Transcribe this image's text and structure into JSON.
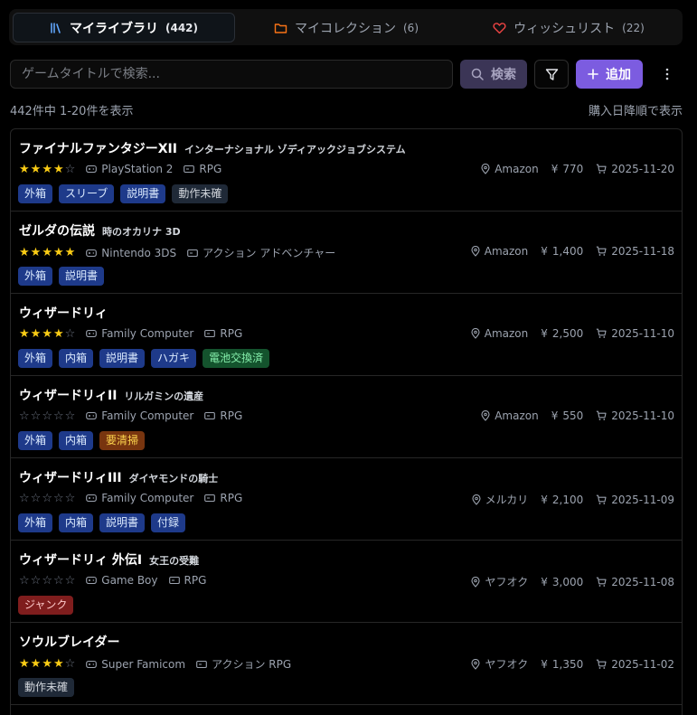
{
  "tabs": [
    {
      "label": "マイライブラリ",
      "count": "(442)",
      "active": true
    },
    {
      "label": "マイコレクション",
      "count": "(6)",
      "active": false
    },
    {
      "label": "ウィッシュリスト",
      "count": "(22)",
      "active": false
    }
  ],
  "search": {
    "placeholder": "ゲームタイトルで検索...",
    "button_label": "検索"
  },
  "toolbar": {
    "add_label": "追加"
  },
  "results": {
    "count_text": "442件中 1-20件を表示",
    "sort_text": "購入日降順で表示"
  },
  "icons": {
    "tab_library": "books-icon",
    "tab_collection": "folder-icon",
    "tab_wishlist": "heart-icon",
    "search": "search-icon",
    "filter": "filter-icon",
    "add": "plus-icon",
    "more": "more-vertical-icon",
    "platform": "gamepad-icon",
    "genre": "cartridge-icon",
    "location": "map-pin-icon",
    "price": "yen-icon",
    "date": "cart-icon",
    "star": "star-icon"
  },
  "colors": {
    "accent": "#7c5ce0",
    "library_tab_icon": "#60a5fa",
    "collection_tab_icon": "#f97316",
    "wishlist_tab_icon": "#ef4444",
    "star_filled": "#facc15",
    "star_empty": "#6b7280"
  },
  "games": [
    {
      "title": "ファイナルファンタジーXII",
      "subtitle": "インターナショナル ゾディアックジョブシステム",
      "rating": 4,
      "platform": "PlayStation 2",
      "genre": "RPG",
      "store": "Amazon",
      "price": "770",
      "date": "2025-11-20",
      "tags": [
        {
          "label": "外箱",
          "color": "blue"
        },
        {
          "label": "スリーブ",
          "color": "blue"
        },
        {
          "label": "説明書",
          "color": "blue"
        },
        {
          "label": "動作未確",
          "color": "gray"
        }
      ]
    },
    {
      "title": "ゼルダの伝説",
      "subtitle": "時のオカリナ 3D",
      "rating": 5,
      "platform": "Nintendo 3DS",
      "genre": "アクション アドベンチャー",
      "store": "Amazon",
      "price": "1,400",
      "date": "2025-11-18",
      "tags": [
        {
          "label": "外箱",
          "color": "blue"
        },
        {
          "label": "説明書",
          "color": "blue"
        }
      ]
    },
    {
      "title": "ウィザードリィ",
      "subtitle": "",
      "rating": 4,
      "platform": "Family Computer",
      "genre": "RPG",
      "store": "Amazon",
      "price": "2,500",
      "date": "2025-11-10",
      "tags": [
        {
          "label": "外箱",
          "color": "blue"
        },
        {
          "label": "内箱",
          "color": "blue"
        },
        {
          "label": "説明書",
          "color": "blue"
        },
        {
          "label": "ハガキ",
          "color": "blue"
        },
        {
          "label": "電池交換済",
          "color": "green"
        }
      ]
    },
    {
      "title": "ウィザードリィII",
      "subtitle": "リルガミンの遺産",
      "rating": 0,
      "platform": "Family Computer",
      "genre": "RPG",
      "store": "Amazon",
      "price": "550",
      "date": "2025-11-10",
      "tags": [
        {
          "label": "外箱",
          "color": "blue"
        },
        {
          "label": "内箱",
          "color": "blue"
        },
        {
          "label": "要清掃",
          "color": "amber"
        }
      ]
    },
    {
      "title": "ウィザードリィIII",
      "subtitle": "ダイヤモンドの騎士",
      "rating": 0,
      "platform": "Family Computer",
      "genre": "RPG",
      "store": "メルカリ",
      "price": "2,100",
      "date": "2025-11-09",
      "tags": [
        {
          "label": "外箱",
          "color": "blue"
        },
        {
          "label": "内箱",
          "color": "blue"
        },
        {
          "label": "説明書",
          "color": "blue"
        },
        {
          "label": "付録",
          "color": "blue"
        }
      ]
    },
    {
      "title": "ウィザードリィ 外伝I",
      "subtitle": "女王の受難",
      "rating": 0,
      "platform": "Game Boy",
      "genre": "RPG",
      "store": "ヤフオク",
      "price": "3,000",
      "date": "2025-11-08",
      "tags": [
        {
          "label": "ジャンク",
          "color": "red"
        }
      ]
    },
    {
      "title": "ソウルブレイダー",
      "subtitle": "",
      "rating": 4,
      "platform": "Super Famicom",
      "genre": "アクション RPG",
      "store": "ヤフオク",
      "price": "1,350",
      "date": "2025-11-02",
      "tags": [
        {
          "label": "動作未確",
          "color": "gray"
        }
      ]
    }
  ]
}
